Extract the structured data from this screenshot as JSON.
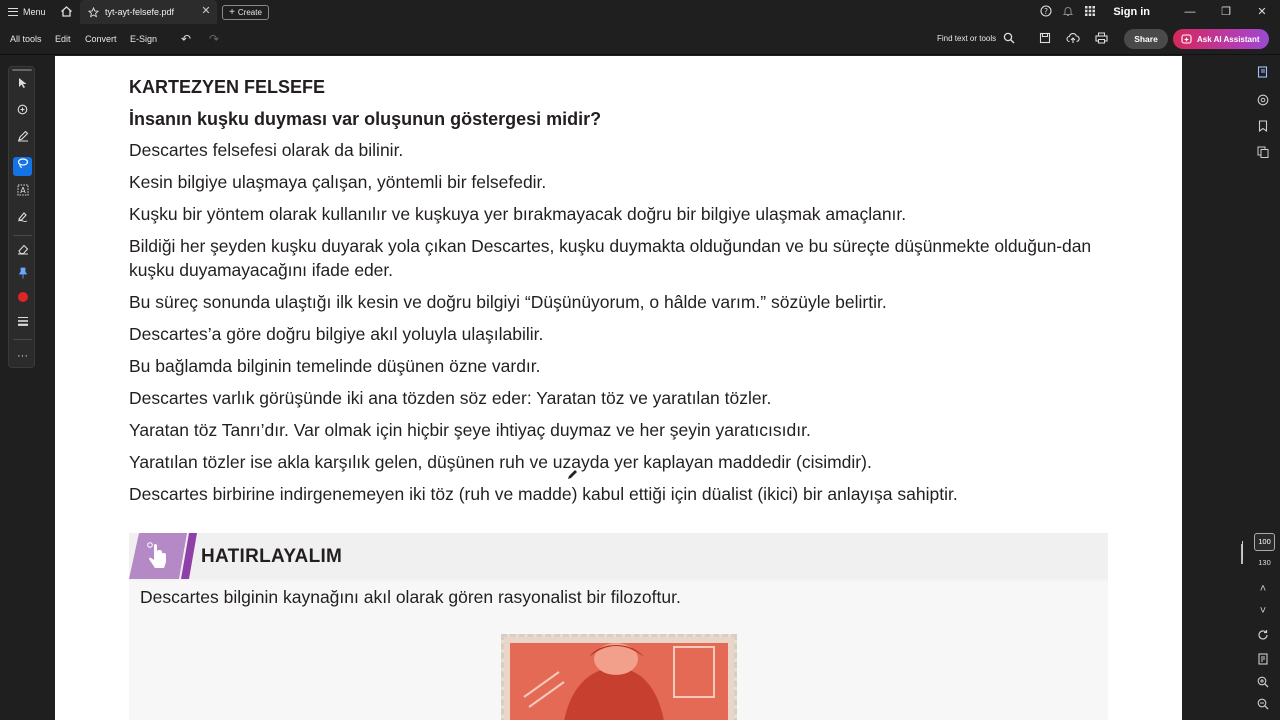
{
  "titlebar": {
    "menu_label": "Menu",
    "tab_title": "tyt-ayt-felsefe.pdf",
    "create_label": "Create",
    "sign_in": "Sign in"
  },
  "toolbar": {
    "menus": [
      "All tools",
      "Edit",
      "Convert",
      "E-Sign"
    ],
    "find_label": "Find text or tools",
    "share_label": "Share",
    "ai_label": "Ask AI Assistant"
  },
  "document": {
    "title": "KARTEZYEN FELSEFE",
    "question": "İnsanın kuşku duyması var oluşunun göstergesi midir?",
    "paragraphs": [
      "Descartes felsefesi olarak da bilinir.",
      "Kesin bilgiye ulaşmaya çalışan, yöntemli bir felsefedir.",
      "Kuşku bir yöntem olarak kullanılır ve kuşkuya yer bırakmayacak doğru bir bilgiye ulaşmak amaçlanır.",
      "Bildiği her şeyden kuşku duyarak yola çıkan Descartes, kuşku duymakta olduğundan ve bu süreçte düşünmekte olduğun-dan kuşku duyamayacağını ifade eder.",
      "Bu süreç sonunda ulaştığı ilk kesin ve doğru bilgiyi “Düşünüyorum, o hâlde varım.” sözüyle belirtir.",
      "Descartes’a göre doğru bilgiye akıl yoluyla ulaşılabilir.",
      "Bu bağlamda bilginin temelinde düşünen özne vardır.",
      "Descartes varlık görüşünde iki ana tözden söz eder: Yaratan töz ve yaratılan tözler.",
      "Yaratan töz Tanrı’dır. Var olmak için hiçbir şeye ihtiyaç duymaz ve her şeyin yaratıcısıdır.",
      "Yaratılan tözler ise akla karşılık gelen, düşünen ruh ve uzayda yer kaplayan maddedir (cisimdir).",
      "Descartes birbirine indirgenemeyen iki töz (ruh ve madde) kabul ettiği için düalist (ikici) bir anlayışa sahiptir."
    ],
    "callout": {
      "title": "HATIRLAYALIM",
      "body": "Descartes bilginin kaynağını akıl olarak gören rasyonalist bir filozoftur."
    }
  },
  "zoom": {
    "current": "100",
    "next": "130"
  },
  "colors": {
    "accent_blue": "#1473e6",
    "callout_purple": "#8e3fa8",
    "record_red": "#e02424"
  }
}
